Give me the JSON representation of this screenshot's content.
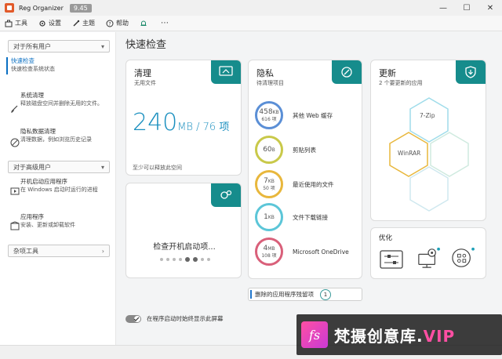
{
  "window": {
    "title": "Reg Organizer",
    "version": "9.45",
    "controls": {
      "minimize": "—",
      "maximize": "☐",
      "close": "✕"
    }
  },
  "menu": {
    "items": [
      {
        "label": "工具",
        "icon": "toolbox-icon"
      },
      {
        "label": "设置",
        "icon": "gear-icon"
      },
      {
        "label": "主题",
        "icon": "theme-icon"
      },
      {
        "label": "帮助",
        "icon": "help-icon"
      }
    ],
    "more": "⋯"
  },
  "sidebar": {
    "group_all_users": "对于所有用户",
    "group_advanced": "对于高级用户",
    "group_misc": "杂项工具",
    "items": [
      {
        "title": "快速检查",
        "desc": "快速检查系统状态"
      },
      {
        "title": "系统清理",
        "desc": "释放磁盘空间并删除无用的文件。"
      },
      {
        "title": "隐私数据清理",
        "desc": "清理数据，例如浏览历史记录"
      },
      {
        "title": "开机启动应用程序",
        "desc": "在 Windows 启动时运行的进程"
      },
      {
        "title": "应用程序",
        "desc": "安装、更新或卸载软件"
      }
    ]
  },
  "main": {
    "title": "快速检查",
    "clean": {
      "title": "清理",
      "subtitle": "无用文件",
      "value": "240",
      "unit": "MB / 76 项",
      "footer": "至少可以释放此空间"
    },
    "startup": {
      "label": "检查开机启动项..."
    },
    "privacy": {
      "title": "隐私",
      "subtitle": "待清理项目",
      "rows": [
        {
          "value": "458",
          "unit": "KB",
          "sub": "616 项",
          "label": "其他 Web 缓存",
          "color": "#5b8fd6"
        },
        {
          "value": "60",
          "unit": "B",
          "sub": "",
          "label": "剪贴列表",
          "color": "#c9c94a"
        },
        {
          "value": "7",
          "unit": "KB",
          "sub": "50 项",
          "label": "最近使用的文件",
          "color": "#e8b73c"
        },
        {
          "value": "1",
          "unit": "KB",
          "sub": "",
          "label": "文件下载链接",
          "color": "#5cc6d8"
        },
        {
          "value": "4",
          "unit": "MB",
          "sub": "108 项",
          "label": "Microsoft OneDrive",
          "color": "#d9607a"
        }
      ]
    },
    "updates": {
      "title": "更新",
      "subtitle": "2 个要更新的应用",
      "apps": [
        "7-Zip",
        "WinRAR"
      ]
    },
    "optimize": {
      "title": "优化"
    },
    "leftovers": {
      "label": "删除的应用程序残留项",
      "count": "1"
    },
    "toggle_label": "在程序启动时始终显示此屏幕"
  },
  "watermark": {
    "logo": "fs",
    "text": "梵摄创意库.",
    "vip": "VIP"
  },
  "colors": {
    "accent_teal": "#168c8c",
    "accent_blue": "#1a8fbf"
  }
}
